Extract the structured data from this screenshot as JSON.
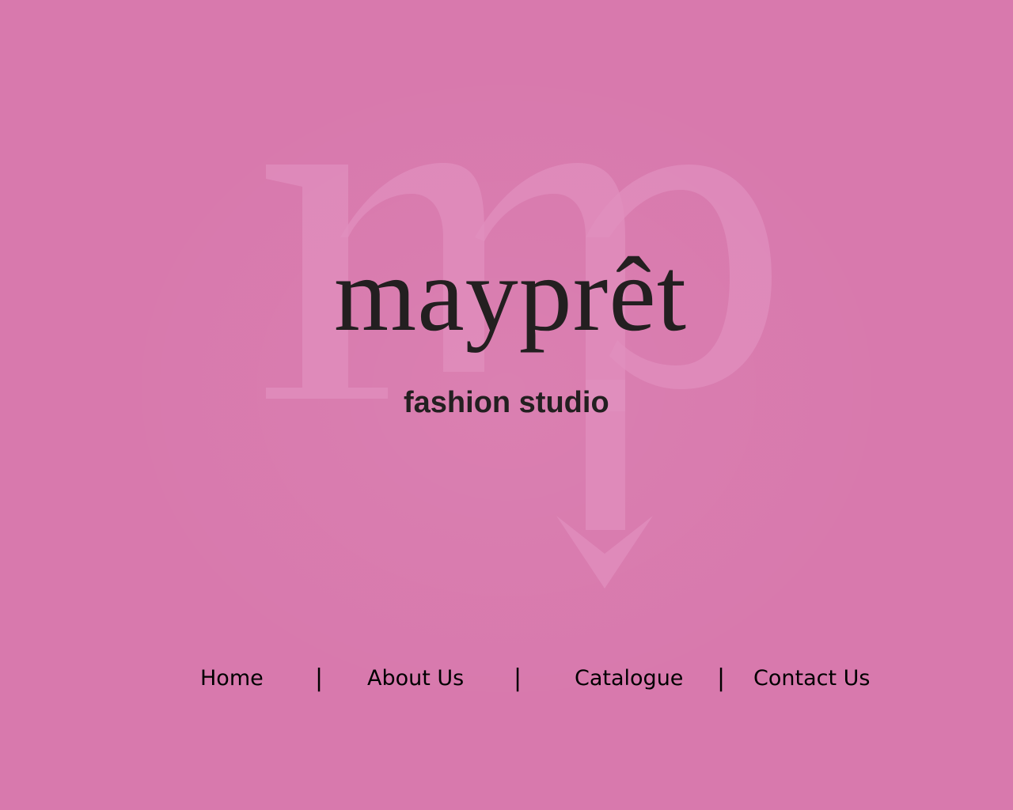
{
  "brand": {
    "name": "mayprêt",
    "tagline": "fashion studio",
    "monogram": "mp",
    "background_color": "#d879ad",
    "monogram_color": "#e090bc",
    "text_color": "#231f20"
  },
  "nav": {
    "items": [
      {
        "label": "Home"
      },
      {
        "label": "About  Us"
      },
      {
        "label": "Catalogue"
      },
      {
        "label": "Contact Us"
      }
    ],
    "separator": "|"
  }
}
